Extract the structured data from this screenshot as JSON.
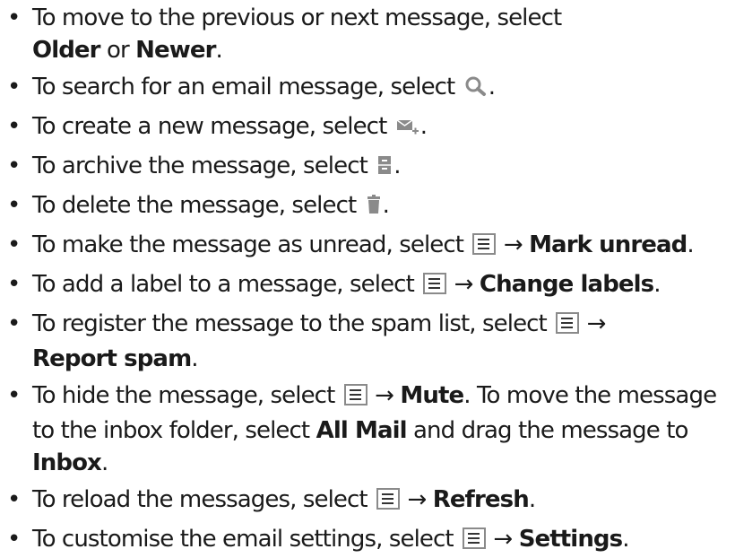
{
  "bullet_char": "•",
  "arrow": "→",
  "items": [
    {
      "pre": "To move to the previous or next message, select ",
      "b1": "Older",
      "mid": " or ",
      "b2": "Newer",
      "post": "."
    },
    {
      "pre": "To search for an email message, select ",
      "icon": "search-icon",
      "post": "."
    },
    {
      "pre": "To create a new message, select ",
      "icon": "compose-mail-icon",
      "post": "."
    },
    {
      "pre": "To archive the message, select ",
      "icon": "archive-icon",
      "post": "."
    },
    {
      "pre": "To delete the message, select ",
      "icon": "trash-icon",
      "post": "."
    },
    {
      "pre": "To make the message as unread, select ",
      "icon": "menu-icon",
      "b1": "Mark unread",
      "post": "."
    },
    {
      "pre": "To add a label to a message, select ",
      "icon": "menu-icon",
      "b1": "Change labels",
      "post": "."
    },
    {
      "pre": "To register the message to the spam list, select ",
      "icon": "menu-icon",
      "b1": "Report spam",
      "post": "."
    },
    {
      "pre": "To hide the message, select ",
      "icon": "menu-icon",
      "b1": "Mute",
      "mid": ". To move the message to the inbox folder, select ",
      "b2": "All Mail",
      "mid2": " and drag the message to ",
      "b3": "Inbox",
      "post": "."
    },
    {
      "pre": "To reload the messages, select ",
      "icon": "menu-icon",
      "b1": "Refresh",
      "post": "."
    },
    {
      "pre": "To customise the email settings, select ",
      "icon": "menu-icon",
      "b1": "Settings",
      "post": "."
    }
  ]
}
